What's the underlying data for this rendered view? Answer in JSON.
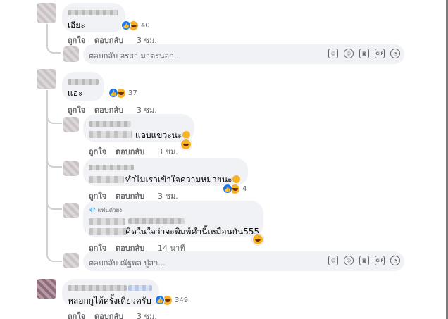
{
  "comments": [
    {
      "text": "เอียะ",
      "reaction_count": "40",
      "like_label": "ถูกใจ",
      "reply_label": "ตอบกลับ",
      "time": "3 ชม.",
      "reply_placeholder": "ตอบกลับ อรสา มาตรนอก..."
    },
    {
      "text": "แอะ",
      "reaction_count": "37",
      "like_label": "ถูกใจ",
      "reply_label": "ตอบกลับ",
      "time": "3 ชม.",
      "replies": [
        {
          "text": "แอบแขวะนะ",
          "like_label": "ถูกใจ",
          "reply_label": "ตอบกลับ",
          "time": "3 ชม."
        },
        {
          "text": "ทำไมเราเข้าใจความหมายนะ",
          "reaction_count": "4",
          "like_label": "ถูกใจ",
          "reply_label": "ตอบกลับ",
          "time": "3 ชม."
        },
        {
          "badge": "แฟนตัวยง",
          "text": "คิดในใจว่าจะพิมพ์คำนี้เหมือนกัน555",
          "like_label": "ถูกใจ",
          "reply_label": "ตอบกลับ",
          "time": "14 นาที"
        }
      ],
      "reply_placeholder": "ตอบกลับ ณัฐพล ปู่สา..."
    },
    {
      "text": "หลอกกูได้ครั้งเดียวครับ",
      "reaction_count": "349",
      "like_label": "ถูกใจ",
      "reply_label": "ตอบกลับ",
      "time": "3 ชม."
    }
  ],
  "reply_box_icons": [
    "sticker-face-icon",
    "emoji-icon",
    "camera-icon",
    "gif-icon",
    "sticker-icon"
  ],
  "colors": {
    "bubble": "#f0f2f5",
    "like_blue": "#1877f2",
    "haha_yellow": "#f7b125",
    "meta_gray": "#65676b"
  }
}
